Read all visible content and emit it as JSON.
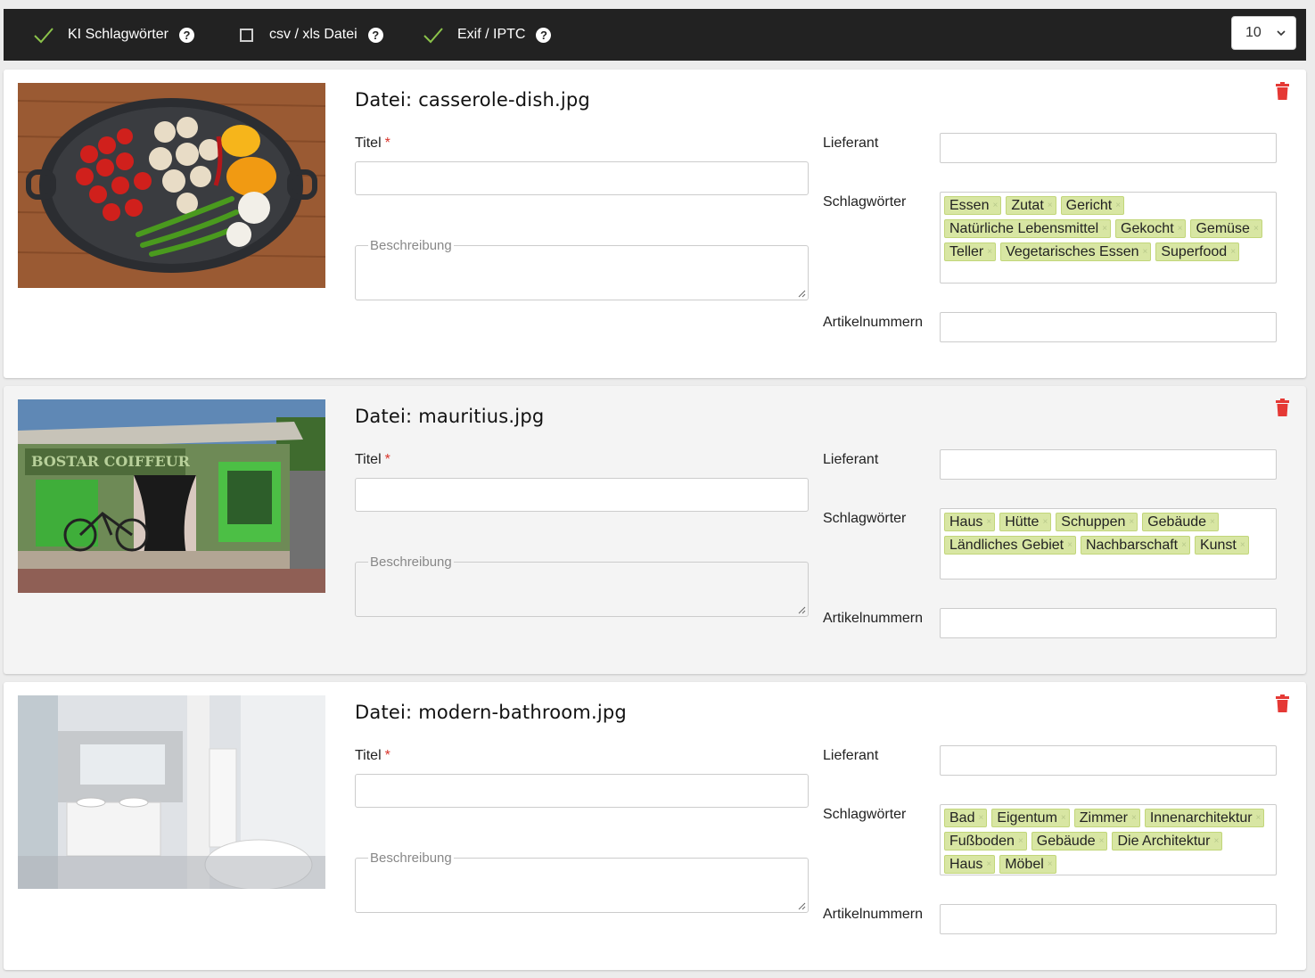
{
  "toolbar": {
    "opt_ki": {
      "label": "KI Schlagwörter",
      "checked": true
    },
    "opt_csv": {
      "label": "csv / xls Datei",
      "checked": false
    },
    "opt_exif": {
      "label": "Exif / IPTC",
      "checked": true
    },
    "help_glyph": "?",
    "per_page": "10"
  },
  "labels": {
    "file_prefix": "Datei: ",
    "titel": "Titel",
    "required_mark": "*",
    "beschreibung": "Beschreibung",
    "lieferant": "Lieferant",
    "schlagwoerter": "Schlagwörter",
    "artikelnummern": "Artikelnummern",
    "tag_remove": "×"
  },
  "colors": {
    "accent_check": "#8bc34a",
    "delete_red": "#e53935",
    "tag_bg": "#d8e6a3"
  },
  "items": [
    {
      "filename": "casserole-dish.jpg",
      "tags": [
        "Essen",
        "Zutat",
        "Gericht",
        "Natürliche Lebensmittel",
        "Gekocht",
        "Gemüse",
        "Teller",
        "Vegetarisches Essen",
        "Superfood"
      ]
    },
    {
      "filename": "mauritius.jpg",
      "tags": [
        "Haus",
        "Hütte",
        "Schuppen",
        "Gebäude",
        "Ländliches Gebiet",
        "Nachbarschaft",
        "Kunst"
      ]
    },
    {
      "filename": "modern-bathroom.jpg",
      "tags": [
        "Bad",
        "Eigentum",
        "Zimmer",
        "Innenarchitektur",
        "Fußboden",
        "Gebäude",
        "Die Architektur",
        "Haus",
        "Möbel"
      ]
    }
  ]
}
